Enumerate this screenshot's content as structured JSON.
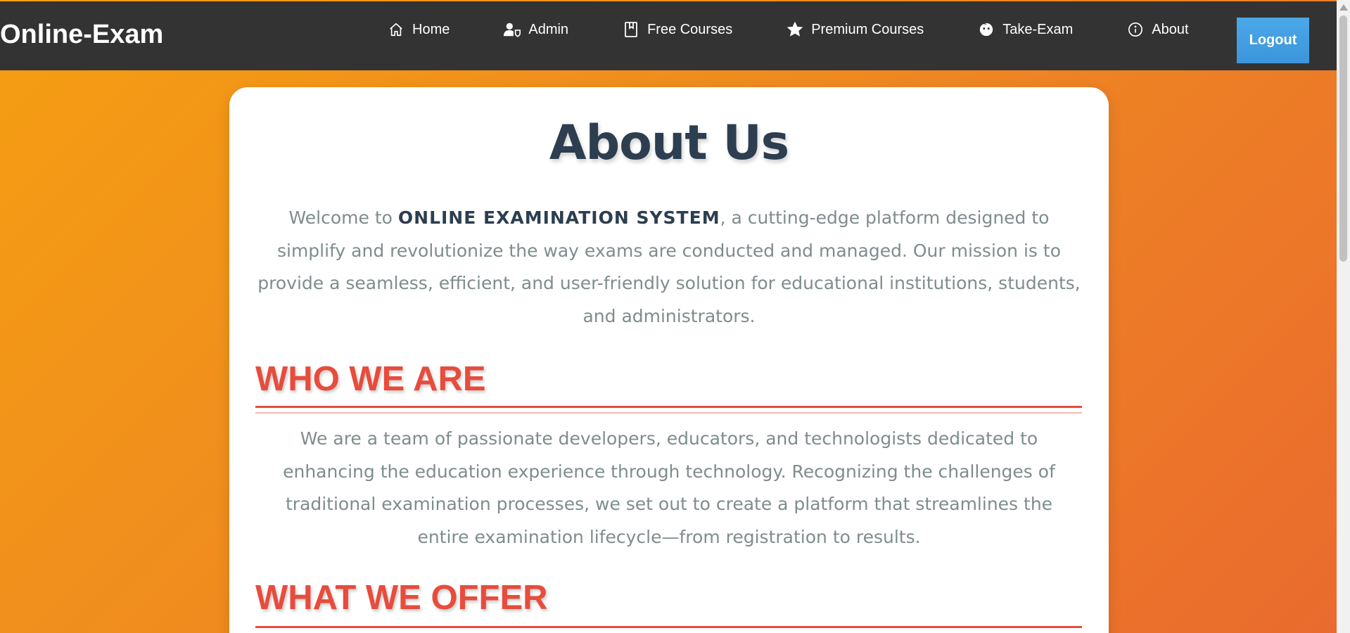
{
  "navbar": {
    "brand": "Online-Exam",
    "items": [
      {
        "label": "Home",
        "icon": "home-icon"
      },
      {
        "label": "Admin",
        "icon": "admin-user-icon"
      },
      {
        "label": "Free Courses",
        "icon": "book-icon"
      },
      {
        "label": "Premium Courses",
        "icon": "star-icon"
      },
      {
        "label": "Take-Exam",
        "icon": "face-icon"
      },
      {
        "label": "About",
        "icon": "info-icon"
      }
    ],
    "logout_label": "Logout"
  },
  "colors": {
    "navbar_bg": "#333333",
    "logout_bg": "#3d95db",
    "title": "#2c3e50",
    "body_text": "#7f8c8d",
    "section_heading": "#e74c3c",
    "background_start": "#f59e12",
    "background_end": "#ea6a2e"
  },
  "about": {
    "title": "About Us",
    "intro_prefix": "Welcome to ",
    "intro_strong": "ONLINE EXAMINATION SYSTEM",
    "intro_suffix": ", a cutting-edge platform designed to simplify and revolutionize the way exams are conducted and managed. Our mission is to provide a seamless, efficient, and user-friendly solution for educational institutions, students, and administrators.",
    "sections": [
      {
        "heading": "WHO WE ARE",
        "body": "We are a team of passionate developers, educators, and technologists dedicated to enhancing the education experience through technology. Recognizing the challenges of traditional examination processes, we set out to create a platform that streamlines the entire examination lifecycle—from registration to results."
      },
      {
        "heading": "WHAT WE OFFER",
        "body": ""
      }
    ]
  }
}
